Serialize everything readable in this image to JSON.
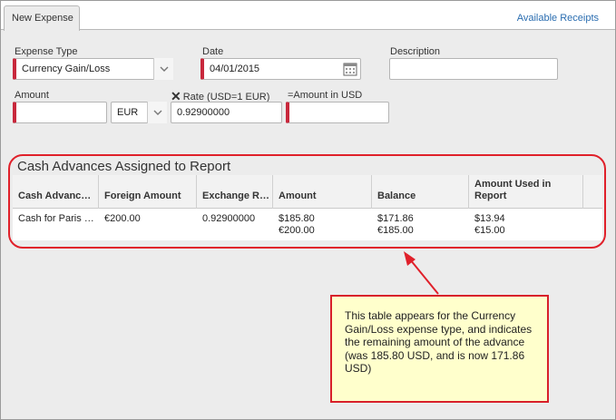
{
  "tabs": {
    "active": "New Expense"
  },
  "available_receipts": "Available Receipts",
  "form": {
    "expense_type": {
      "label": "Expense Type",
      "value": "Currency Gain/Loss"
    },
    "date": {
      "label": "Date",
      "value": "04/01/2015"
    },
    "description": {
      "label": "Description",
      "value": ""
    },
    "amount": {
      "label": "Amount",
      "value": ""
    },
    "currency": {
      "value": "EUR"
    },
    "rate": {
      "label": "Rate (USD=1 EUR)",
      "value": "0.92900000"
    },
    "amount_in_usd": {
      "label": "=Amount in USD",
      "value": ""
    }
  },
  "cash_advances": {
    "title": "Cash Advances Assigned to Report",
    "columns": [
      "Cash Advanc…",
      "Foreign Amount",
      "Exchange R…",
      "Amount",
      "Balance",
      "Amount Used in Report"
    ],
    "rows": [
      {
        "name": "Cash for Paris …",
        "foreign_amount": "€200.00",
        "exchange_rate": "0.92900000",
        "amount_usd": "$185.80",
        "amount_eur": "€200.00",
        "balance_usd": "$171.86",
        "balance_eur": "€185.00",
        "used_usd": "$13.94",
        "used_eur": "€15.00"
      }
    ]
  },
  "callout": "This table appears for the Currency Gain/Loss expense type, and indicates the remaining amount of the advance (was 185.80 USD, and is now 171.86 USD)",
  "colors": {
    "required": "#c8283c",
    "link": "#2a6db0",
    "annotation_red": "#e0202a",
    "callout_bg": "#ffffcc"
  },
  "icons": [
    "chevron-down-icon",
    "calendar-icon",
    "close-icon",
    "arrow-icon"
  ]
}
